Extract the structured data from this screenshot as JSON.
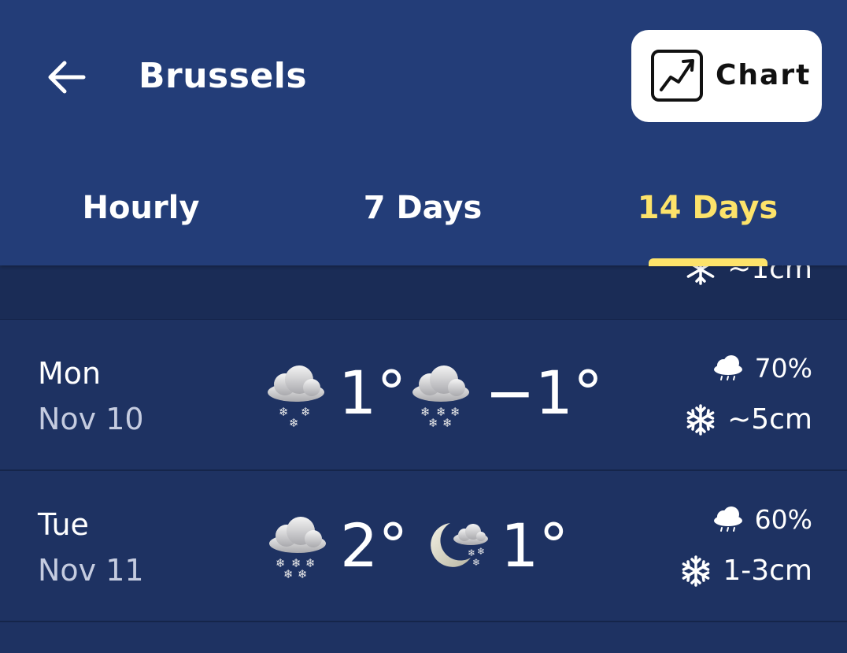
{
  "header": {
    "title": "Brussels",
    "chart_label": "Chart"
  },
  "tabs": [
    {
      "label": "Hourly",
      "active": false
    },
    {
      "label": "7 Days",
      "active": false
    },
    {
      "label": "14 Days",
      "active": true
    }
  ],
  "partial_row": {
    "snow": "~1cm"
  },
  "days": [
    {
      "day": "Mon",
      "date": "Nov 10",
      "day_icon": "snow-cloud-icon",
      "high": "1°",
      "night_icon": "snow-cloud-icon",
      "low": "−1°",
      "precip_chance": "70%",
      "snow": "~5cm"
    },
    {
      "day": "Tue",
      "date": "Nov 11",
      "day_icon": "snow-cloud-icon",
      "high": "2°",
      "night_icon": "moon-snow-cloud-icon",
      "low": "1°",
      "precip_chance": "60%",
      "snow": "1-3cm"
    }
  ],
  "colors": {
    "header_bg": "#233d78",
    "list_bg": "#1e3262",
    "active_tab": "#fde36a",
    "secondary_text": "#c5cce0"
  }
}
